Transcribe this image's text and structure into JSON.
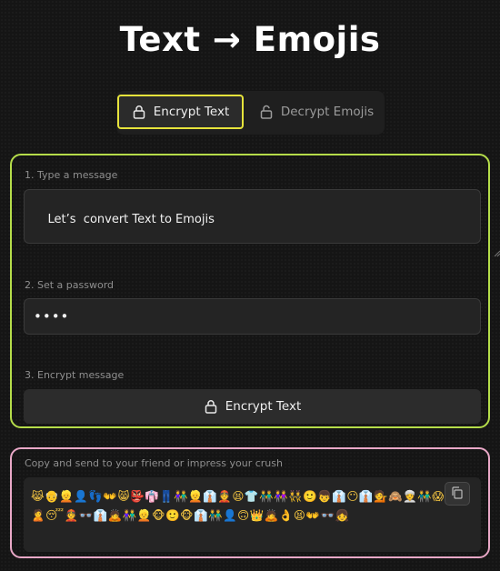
{
  "header": {
    "title": "Text  → Emojis"
  },
  "tabs": {
    "encrypt_label": "Encrypt Text",
    "decrypt_label": "Decrypt Emojis",
    "active": "encrypt"
  },
  "form": {
    "message_label": "1. Type a message",
    "message_value": "Let’s  convert Text to Emojis",
    "password_label": "2. Set a password",
    "password_masked": "••••",
    "encrypt_label": "3. Encrypt message",
    "encrypt_button_label": "Encrypt Text"
  },
  "output": {
    "label": "Copy and send to your friend or impress your crush",
    "emojis": "😹👴👱👤👣👐😸👺👘👖👫👱👔👲😫👕👬👭👯🙂👦👔😶👔💁🙈👳👬😱😳👬🙎😴👲👓👔🙇👫👱🐵🙂🐵👔👬👤🙃👑🙇👌😫👐👓👧",
    "icons": {
      "copy": "copy-icon",
      "lock": "lock-icon"
    }
  },
  "colors": {
    "tab_active_border": "#e6e33b",
    "form_panel_border": "#b5dd4a",
    "output_panel_border": "#e9a8c7",
    "background": "#151515",
    "field_background": "#242424"
  }
}
